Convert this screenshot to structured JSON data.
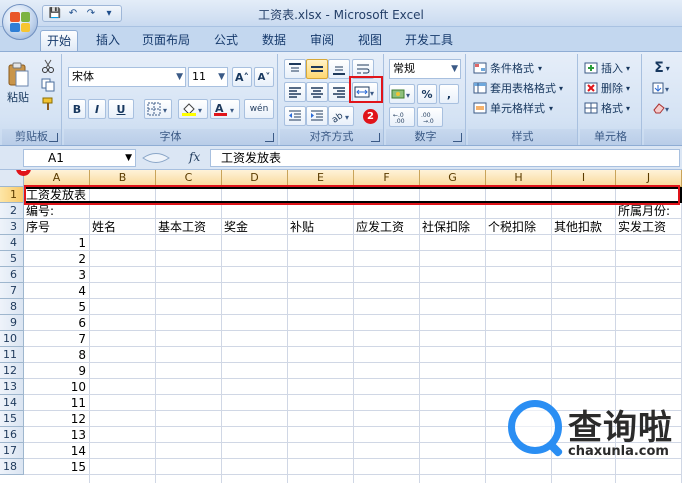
{
  "window": {
    "title": "工资表.xlsx - Microsoft Excel",
    "qat": [
      "💾",
      "↶",
      "↷",
      "▾"
    ]
  },
  "tabs": [
    "开始",
    "插入",
    "页面布局",
    "公式",
    "数据",
    "审阅",
    "视图",
    "开发工具"
  ],
  "active_tab": "开始",
  "ribbon": {
    "clipboard": {
      "label": "剪贴板",
      "paste": "粘贴"
    },
    "font": {
      "label": "字体",
      "font_name": "宋体",
      "font_size": "11",
      "grow": "A˄",
      "shrink": "A˅",
      "bold": "B",
      "italic": "I",
      "underline": "U",
      "wen": "wén"
    },
    "alignment": {
      "label": "对齐方式"
    },
    "number": {
      "label": "数字",
      "format": "常规",
      "percent": "%",
      "comma": ","
    },
    "styles": {
      "label": "样式",
      "conditional": "条件格式",
      "table": "套用表格格式",
      "cell_styles": "单元格样式"
    },
    "cells": {
      "label": "单元格",
      "insert": "插入",
      "delete": "删除",
      "format": "格式"
    },
    "editing": {
      "sigma": "Σ"
    }
  },
  "formula_bar": {
    "name_box": "A1",
    "fx": "fx",
    "content": "工资发放表"
  },
  "columns": [
    "A",
    "B",
    "C",
    "D",
    "E",
    "F",
    "G",
    "H",
    "I",
    "J"
  ],
  "rows": [
    "1",
    "2",
    "3",
    "4",
    "5",
    "6",
    "7",
    "8",
    "9",
    "10",
    "11",
    "12",
    "13",
    "14",
    "15",
    "16",
    "17",
    "18"
  ],
  "sheet": {
    "a1": "工资发放表",
    "a2": "编号:",
    "j2": "所属月份:",
    "headers": [
      "序号",
      "姓名",
      "基本工资",
      "奖金",
      "补贴",
      "应发工资",
      "社保扣除",
      "个税扣除",
      "其他扣款",
      "实发工资"
    ],
    "serials": [
      "1",
      "2",
      "3",
      "4",
      "5",
      "6",
      "7",
      "8",
      "9",
      "10",
      "11",
      "12",
      "13",
      "14",
      "15"
    ]
  },
  "annotations": {
    "badge1": "1",
    "badge2": "2"
  },
  "colors": {
    "accent": "#e0141a",
    "watermark_blue": "#2a8ef3"
  },
  "watermark": {
    "text": "查询啦",
    "sub": "chaxunla.com"
  }
}
